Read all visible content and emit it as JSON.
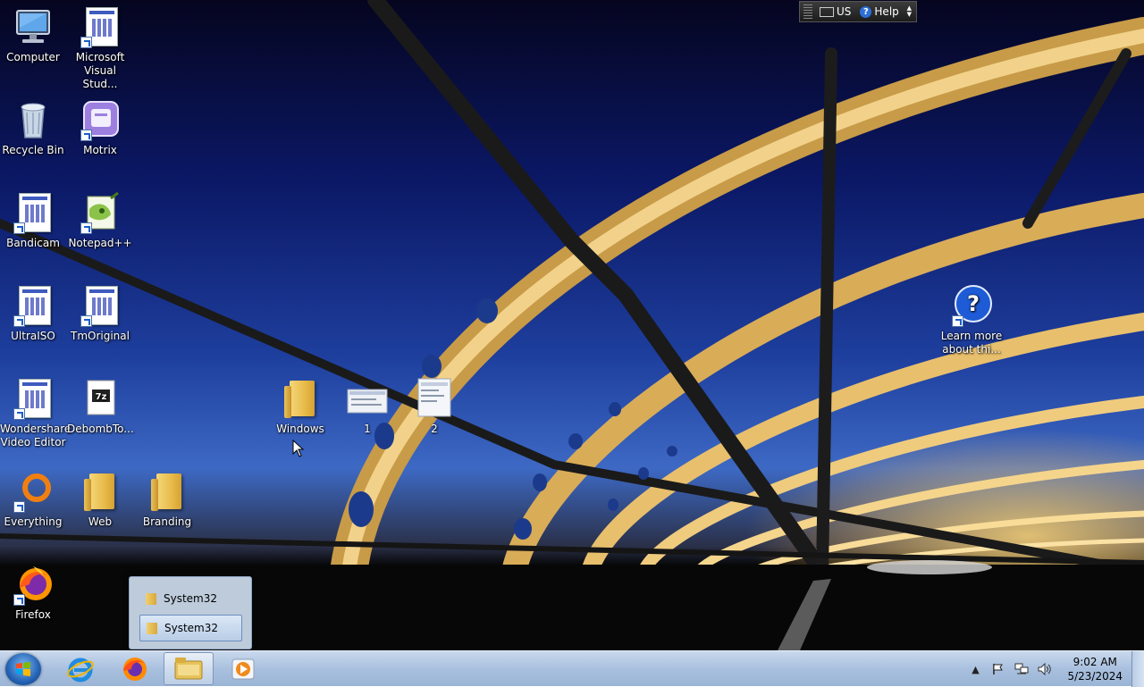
{
  "desktop": {
    "icons": [
      {
        "label": "Computer"
      },
      {
        "label": "Microsoft Visual Stud..."
      },
      {
        "label": "Recycle Bin"
      },
      {
        "label": "Motrix"
      },
      {
        "label": "Bandicam"
      },
      {
        "label": "Notepad++"
      },
      {
        "label": "UltraISO"
      },
      {
        "label": "TmOriginal"
      },
      {
        "label": "Wondershare Video Editor"
      },
      {
        "label": "DebombTo..."
      },
      {
        "label": "Everything"
      },
      {
        "label": "Web"
      },
      {
        "label": "Branding"
      },
      {
        "label": "Firefox"
      },
      {
        "label": "Windows"
      },
      {
        "label": "1"
      },
      {
        "label": "2"
      },
      {
        "label": "Learn more about thi..."
      }
    ]
  },
  "language_bar": {
    "language": "US",
    "help_label": "Help"
  },
  "taskbar_popup": {
    "items": [
      {
        "label": "System32",
        "selected": false
      },
      {
        "label": "System32",
        "selected": true
      }
    ]
  },
  "taskbar": {
    "pinned": [
      {
        "icon": "internet-explorer-icon"
      },
      {
        "icon": "firefox-icon"
      },
      {
        "icon": "windows-explorer-icon",
        "active": true
      },
      {
        "icon": "media-player-icon"
      }
    ],
    "clock": {
      "time": "9:02 AM",
      "date": "5/23/2024"
    }
  }
}
